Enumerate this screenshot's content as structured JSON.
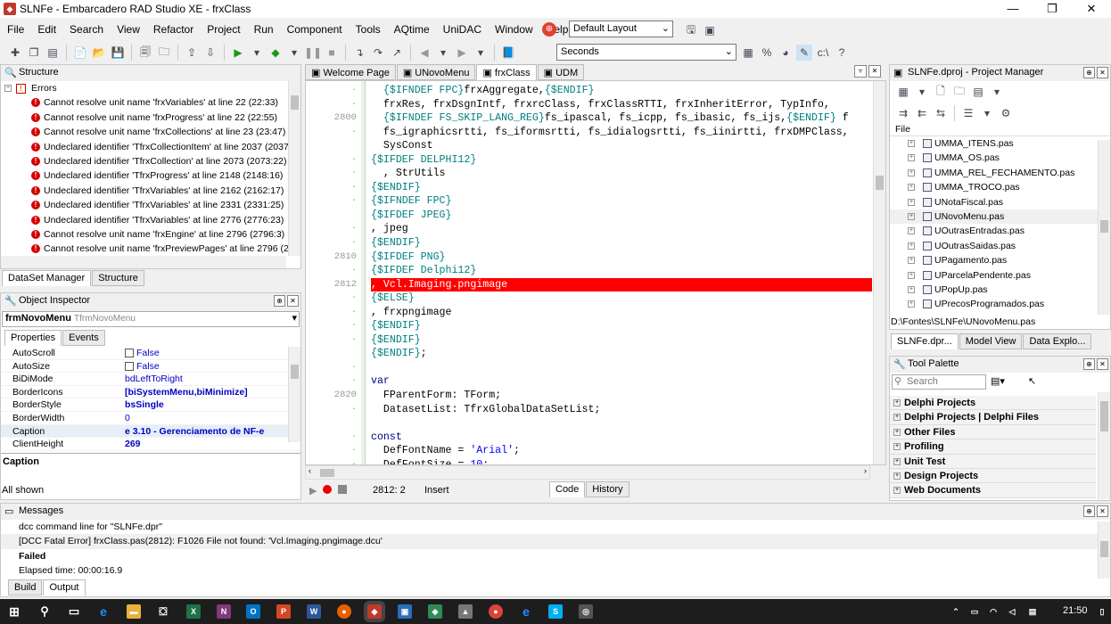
{
  "window": {
    "title": "SLNFe - Embarcadero RAD Studio XE - frxClass",
    "min": "—",
    "restore": "❐",
    "close": "✕"
  },
  "menu": [
    "File",
    "Edit",
    "Search",
    "View",
    "Refactor",
    "Project",
    "Run",
    "Component",
    "Tools",
    "AQtime",
    "UniDAC",
    "Window",
    "Help"
  ],
  "layout_select": "Default Layout",
  "seconds_select": "Seconds",
  "structure": {
    "title": "Structure",
    "root": "Errors",
    "errors": [
      "Cannot resolve unit name 'frxVariables' at line 22 (22:33)",
      "Cannot resolve unit name 'frxProgress' at line 22 (22:55)",
      "Cannot resolve unit name 'frxCollections' at line 23 (23:47)",
      "Undeclared identifier 'TfrxCollectionItem' at line 2037 (2037:2!",
      "Undeclared identifier 'TfrxCollection' at line 2073 (2073:22)",
      "Undeclared identifier 'TfrxProgress' at line 2148 (2148:16)",
      "Undeclared identifier 'TfrxVariables' at line 2162 (2162:17)",
      "Undeclared identifier 'TfrxVariables' at line 2331 (2331:25)",
      "Undeclared identifier 'TfrxVariables' at line 2776 (2776:23)",
      "Cannot resolve unit name 'frxEngine' at line 2796 (2796:3)",
      "Cannot resolve unit name 'frxPreviewPages' at line 2796 (279("
    ],
    "bottom_tabs": [
      "DataSet Manager",
      "Structure"
    ]
  },
  "object_inspector": {
    "title": "Object Inspector",
    "object_name": "frmNovoMenu",
    "object_type": "TfrmNovoMenu",
    "tabs": [
      "Properties",
      "Events"
    ],
    "rows": [
      {
        "k": "AutoScroll",
        "v": "False",
        "chk": true
      },
      {
        "k": "AutoSize",
        "v": "False",
        "chk": true
      },
      {
        "k": "BiDiMode",
        "v": "bdLeftToRight"
      },
      {
        "k": "BorderIcons",
        "v": "[biSystemMenu,biMinimize]",
        "bold": true,
        "exp": true
      },
      {
        "k": "BorderStyle",
        "v": "bsSingle",
        "bold": true
      },
      {
        "k": "BorderWidth",
        "v": "0"
      },
      {
        "k": "Caption",
        "v": "e 3.10 - Gerenciamento de NF-e",
        "bold": true,
        "sel": true
      },
      {
        "k": "ClientHeight",
        "v": "269",
        "bold": true
      }
    ],
    "desc_title": "Caption",
    "status": "All shown"
  },
  "editor": {
    "tabs": [
      "Welcome Page",
      "UNovoMenu",
      "frxClass",
      "UDM"
    ],
    "active_tab": 2,
    "lines": [
      {
        "n": "",
        "t": [
          {
            "c": "dir",
            "s": "  {$IFNDEF FPC}"
          },
          {
            "c": "",
            "s": "frxAggregate"
          },
          {
            "c": "",
            "s": ","
          },
          {
            "c": "dir",
            "s": "{$ENDIF}"
          }
        ]
      },
      {
        "n": "",
        "t": [
          {
            "c": "",
            "s": "  frxRes, frxDsgnIntf, frxrcClass, frxClassRTTI, frxInheritError, TypInfo,"
          }
        ]
      },
      {
        "n": "2800",
        "t": [
          {
            "c": "dir",
            "s": "  {$IFNDEF FS_SKIP_LANG_REG}"
          },
          {
            "c": "",
            "s": "fs_ipascal, fs_icpp, fs_ibasic, fs_ijs,"
          },
          {
            "c": "dir",
            "s": "{$ENDIF}"
          },
          {
            "c": "",
            "s": " f"
          }
        ]
      },
      {
        "n": "",
        "t": [
          {
            "c": "",
            "s": "  fs_igraphicsrtti, fs_iformsrtti, fs_idialogsrtti, fs_iinirtti, frxDMPClass,"
          }
        ]
      },
      {
        "n": "",
        "t": [
          {
            "c": "",
            "s": "  SysConst"
          }
        ]
      },
      {
        "n": "",
        "t": [
          {
            "c": "dir",
            "s": "{$IFDEF DELPHI12}"
          }
        ]
      },
      {
        "n": "",
        "t": [
          {
            "c": "",
            "s": "  , StrUtils"
          }
        ]
      },
      {
        "n": "",
        "t": [
          {
            "c": "dir",
            "s": "{$ENDIF}"
          }
        ]
      },
      {
        "n": "",
        "t": [
          {
            "c": "dir",
            "s": "{$IFNDEF FPC}"
          }
        ]
      },
      {
        "n": "",
        "t": [
          {
            "c": "dir",
            "s": "{$IFDEF JPEG}"
          }
        ]
      },
      {
        "n": "",
        "t": [
          {
            "c": "",
            "s": ", jpeg"
          }
        ]
      },
      {
        "n": "",
        "t": [
          {
            "c": "dir",
            "s": "{$ENDIF}"
          }
        ]
      },
      {
        "n": "2810",
        "t": [
          {
            "c": "dir",
            "s": "{$IFDEF PNG}"
          }
        ]
      },
      {
        "n": "",
        "t": [
          {
            "c": "dir",
            "s": "{$IFDEF Delphi12}"
          }
        ]
      },
      {
        "n": "2812",
        "hl": true,
        "t": [
          {
            "c": "",
            "s": ", Vcl.Imaging.pngimage"
          }
        ]
      },
      {
        "n": "",
        "t": [
          {
            "c": "dir",
            "s": "{$ELSE}"
          }
        ]
      },
      {
        "n": "",
        "t": [
          {
            "c": "",
            "s": ", frxpngimage"
          }
        ]
      },
      {
        "n": "",
        "t": [
          {
            "c": "dir",
            "s": "{$ENDIF}"
          }
        ]
      },
      {
        "n": "",
        "t": [
          {
            "c": "dir",
            "s": "{$ENDIF}"
          }
        ]
      },
      {
        "n": "",
        "t": [
          {
            "c": "dir",
            "s": "{$ENDIF}"
          },
          {
            "c": "",
            "s": ";"
          }
        ]
      },
      {
        "n": "",
        "t": [
          {
            "c": "",
            "s": ""
          }
        ]
      },
      {
        "n": "",
        "t": [
          {
            "c": "kw",
            "s": "var"
          }
        ]
      },
      {
        "n": "2820",
        "t": [
          {
            "c": "",
            "s": "  FParentForm: TForm;"
          }
        ]
      },
      {
        "n": "",
        "t": [
          {
            "c": "",
            "s": "  DatasetList: TfrxGlobalDataSetList;"
          }
        ]
      },
      {
        "n": "",
        "t": [
          {
            "c": "",
            "s": ""
          }
        ]
      },
      {
        "n": "",
        "t": [
          {
            "c": "kw",
            "s": "const"
          }
        ]
      },
      {
        "n": "",
        "t": [
          {
            "c": "",
            "s": "  DefFontName = "
          },
          {
            "c": "str",
            "s": "'Arial'"
          },
          {
            "c": "",
            "s": ";"
          }
        ]
      },
      {
        "n": "",
        "t": [
          {
            "c": "",
            "s": "  DefFontSize = "
          },
          {
            "c": "str",
            "s": "10"
          },
          {
            "c": "",
            "s": ";"
          }
        ]
      }
    ],
    "status_pos": "2812:  2",
    "status_mode": "Insert",
    "bottom_tabs": [
      "Code",
      "History"
    ]
  },
  "project_manager": {
    "title": "SLNFe.dproj - Project Manager",
    "header": "File",
    "files": [
      "UMMA_ITENS.pas",
      "UMMA_OS.pas",
      "UMMA_REL_FECHAMENTO.pas",
      "UMMA_TROCO.pas",
      "UNotaFiscal.pas",
      "UNovoMenu.pas",
      "UOutrasEntradas.pas",
      "UOutrasSaidas.pas",
      "UPagamento.pas",
      "UParcelaPendente.pas",
      "UPopUp.pas",
      "UPrecosProgramados.pas"
    ],
    "path": "D:\\Fontes\\SLNFe\\UNovoMenu.pas",
    "tabs": [
      "SLNFe.dpr...",
      "Model View",
      "Data Explo..."
    ]
  },
  "tool_palette": {
    "title": "Tool Palette",
    "search_placeholder": "Search",
    "categories": [
      "Delphi Projects",
      "Delphi Projects | Delphi Files",
      "Other Files",
      "Profiling",
      "Unit Test",
      "Design Projects",
      "Web Documents"
    ]
  },
  "messages": {
    "title": "Messages",
    "lines": [
      "dcc command line for \"SLNFe.dpr\"",
      "[DCC Fatal Error] frxClass.pas(2812): F1026 File not found: 'Vcl.Imaging.pngimage.dcu'",
      "Failed",
      "Elapsed time: 00:00:16.9"
    ],
    "tabs": [
      "Build",
      "Output"
    ]
  },
  "taskbar": {
    "clock": "21:50"
  }
}
